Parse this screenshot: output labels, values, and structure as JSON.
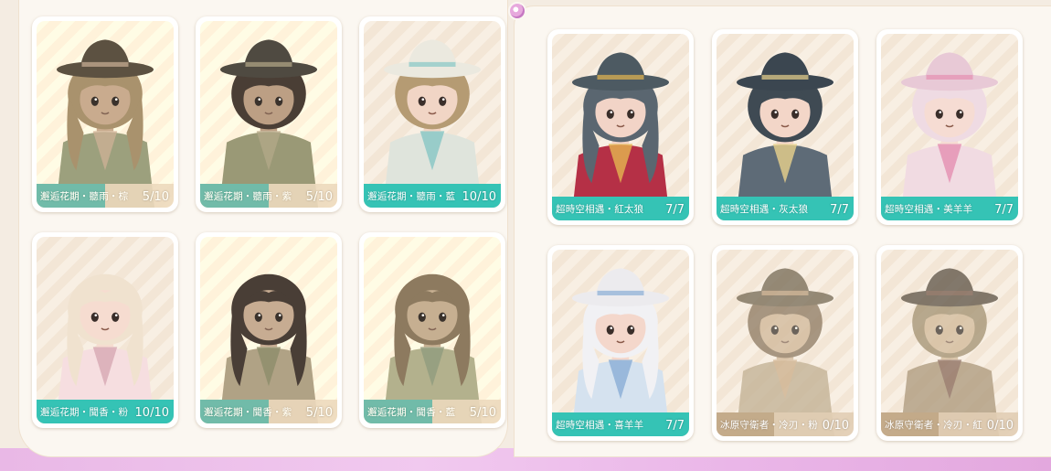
{
  "left_panel": {
    "cards": [
      {
        "label": "邂逅花期・聽雨・棕",
        "count": "5/10",
        "progress": 0.5,
        "theme": {
          "hat": "#5b4c3a",
          "hair": "#a98a58",
          "skin": "#c9a07f",
          "outfit": "#8c9c70",
          "accent": "#caa58a",
          "bg": "#f6ecdf"
        }
      },
      {
        "label": "邂逅花期・聽雨・紫",
        "count": "5/10",
        "progress": 0.5,
        "theme": {
          "hat": "#4b463f",
          "hair": "#4a3a30",
          "skin": "#bd9476",
          "outfit": "#8e9468",
          "accent": "#a9a07a",
          "bg": "#f6ecdf"
        }
      },
      {
        "label": "邂逅花期・聽雨・藍",
        "count": "10/10",
        "progress": 1.0,
        "theme": {
          "hat": "#ebe9df",
          "hair": "#b59b73",
          "skin": "#f1d5c5",
          "outfit": "#dfe4dc",
          "accent": "#86c6c4",
          "bg": "#f8efe3"
        }
      },
      {
        "label": "邂逅花期・聞香・粉",
        "count": "10/10",
        "progress": 1.0,
        "theme": {
          "hat": "",
          "hair": "#f0e2cf",
          "skin": "#f6dcd0",
          "outfit": "#f6dee0",
          "accent": "#d7a7b3",
          "bg": "#fbf1e8"
        }
      },
      {
        "label": "邂逅花期・聞香・紫",
        "count": "5/10",
        "progress": 0.5,
        "theme": {
          "hat": "",
          "hair": "#4a3932",
          "skin": "#c6a186",
          "outfit": "#a99a78",
          "accent": "#7f8a5d",
          "bg": "#f4e6d4"
        }
      },
      {
        "label": "邂逅花期・聞香・藍",
        "count": "5/10",
        "progress": 0.5,
        "theme": {
          "hat": "",
          "hair": "#8c7350",
          "skin": "#c3a583",
          "outfit": "#a5ab7f",
          "accent": "#7c9a75",
          "bg": "#f1e4cf"
        }
      }
    ]
  },
  "right_panel": {
    "cards": [
      {
        "label": "超時空相遇・紅太狼",
        "count": "7/7",
        "progress": 1.0,
        "theme": {
          "hat": "#4d5a62",
          "hair": "#5a6670",
          "skin": "#f2d4c7",
          "outfit": "#b53046",
          "accent": "#e5b650",
          "bg": "#f7ebe0"
        }
      },
      {
        "label": "超時空相遇・灰太狼",
        "count": "7/7",
        "progress": 1.0,
        "theme": {
          "hat": "#3b4650",
          "hair": "#3f4a53",
          "skin": "#f3d6c8",
          "outfit": "#5e6b77",
          "accent": "#e9d28c",
          "bg": "#f7ebe0"
        }
      },
      {
        "label": "超時空相遇・美羊羊",
        "count": "7/7",
        "progress": 1.0,
        "theme": {
          "hat": "#e8c9d6",
          "hair": "#efdbe3",
          "skin": "#f6dcd3",
          "outfit": "#f1dbe2",
          "accent": "#e58fb1",
          "bg": "#f7ebe0"
        }
      },
      {
        "label": "超時空相遇・喜羊羊",
        "count": "7/7",
        "progress": 1.0,
        "theme": {
          "hat": "#ecebee",
          "hair": "#f1f1f4",
          "skin": "#f4d7cb",
          "outfit": "#d5e2ef",
          "accent": "#8aaed6",
          "bg": "#f7ebe0"
        }
      },
      {
        "label": "冰原守衛者・冷刃・粉",
        "count": "0/10",
        "progress": 0.0,
        "theme": {
          "hat": "#6f5e44",
          "hair": "#8a6d4b",
          "skin": "#c8a484",
          "outfit": "#b49f80",
          "accent": "#cf9a66",
          "bg": "#f2e6d6"
        }
      },
      {
        "label": "冰原守衛者・冷刃・紅",
        "count": "0/10",
        "progress": 0.0,
        "theme": {
          "hat": "#56493a",
          "hair": "#9b8457",
          "skin": "#c9a785",
          "outfit": "#a48866",
          "accent": "#8d4a3e",
          "bg": "#f2e6d6"
        }
      }
    ]
  }
}
